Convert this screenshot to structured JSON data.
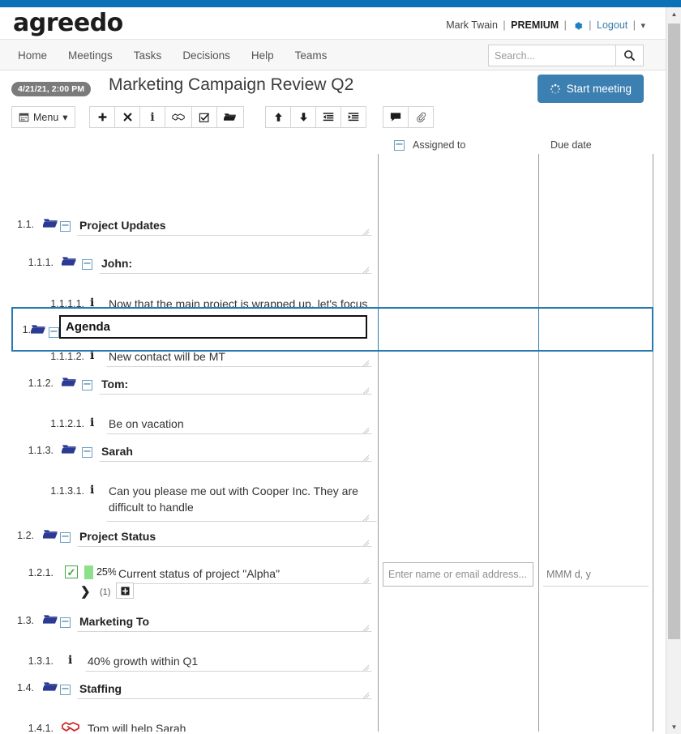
{
  "brand": {
    "name": "agreedo",
    "logo_icon": "agreedo-logo"
  },
  "user": {
    "name": "Mark Twain",
    "plan": "PREMIUM",
    "settings_icon": "gear-icon",
    "logout_label": "Logout",
    "caret_icon": "chevron-down-icon",
    "sep": "|"
  },
  "nav": {
    "items": [
      {
        "label": "Home",
        "name": "nav-home"
      },
      {
        "label": "Meetings",
        "name": "nav-meetings"
      },
      {
        "label": "Tasks",
        "name": "nav-tasks"
      },
      {
        "label": "Decisions",
        "name": "nav-decisions"
      },
      {
        "label": "Help",
        "name": "nav-help"
      },
      {
        "label": "Teams",
        "name": "nav-teams"
      }
    ]
  },
  "search": {
    "placeholder": "Search...",
    "value": "",
    "icon": "search-icon"
  },
  "meeting": {
    "date_badge": "4/21/21, 2:00 PM",
    "title": "Marketing Campaign Review Q2",
    "start_button": "Start meeting",
    "start_button_icon": "spinner-icon"
  },
  "toolbar": {
    "menu_label": "Menu",
    "menu_icon": "calendar-icon",
    "menu_caret": "▾",
    "group1": [
      {
        "icon": "plus-icon",
        "glyph": "✚",
        "name": "add-item-button"
      },
      {
        "icon": "close-icon",
        "glyph": "✖",
        "name": "delete-item-button"
      },
      {
        "icon": "info-icon",
        "glyph": "i",
        "name": "info-item-button"
      },
      {
        "icon": "handshake-icon",
        "glyph": "handshake",
        "name": "decision-item-button"
      },
      {
        "icon": "checkbox-icon",
        "glyph": "☑",
        "name": "task-item-button"
      },
      {
        "icon": "folder-icon",
        "glyph": "folder",
        "name": "topic-item-button"
      }
    ],
    "group2": [
      {
        "icon": "arrow-up-icon",
        "glyph": "↑",
        "name": "move-up-button"
      },
      {
        "icon": "arrow-down-icon",
        "glyph": "↓",
        "name": "move-down-button"
      },
      {
        "icon": "outdent-icon",
        "glyph": "outdent",
        "name": "outdent-button"
      },
      {
        "icon": "indent-icon",
        "glyph": "indent",
        "name": "indent-button"
      }
    ],
    "group3": [
      {
        "icon": "comment-icon",
        "glyph": "💬",
        "name": "comment-button"
      },
      {
        "icon": "paperclip-icon",
        "glyph": "attach",
        "name": "attachment-button"
      }
    ]
  },
  "columns": {
    "collapse_icon": "minus-box-icon",
    "assigned_to": "Assigned to",
    "due_date": "Due date"
  },
  "rows": [
    {
      "number": "1.",
      "type": "topic",
      "text": "Agenda",
      "selected": true,
      "editing": true
    },
    {
      "number": "1.1.",
      "type": "topic",
      "text": "Project Updates"
    },
    {
      "number": "1.1.1.",
      "type": "topic",
      "text": "John:"
    },
    {
      "number": "1.1.1.1.",
      "type": "info",
      "text": "Now that the main project is wrapped up, let's focus on new goals"
    },
    {
      "number": "1.1.1.2.",
      "type": "info",
      "text": "New contact will be MT"
    },
    {
      "number": "1.1.2.",
      "type": "topic",
      "text": "Tom:"
    },
    {
      "number": "1.1.2.1.",
      "type": "info",
      "text": "Be on vacation"
    },
    {
      "number": "1.1.3.",
      "type": "topic",
      "text": "Sarah"
    },
    {
      "number": "1.1.3.1.",
      "type": "info",
      "text": "Can you please me out with Cooper Inc. They are difficult to handle"
    },
    {
      "number": "1.2.",
      "type": "topic",
      "text": "Project Status"
    },
    {
      "number": "1.2.1.",
      "type": "task",
      "text": "Current status of project \"Alpha\"",
      "progress": "25%",
      "progress_value": 25,
      "checked": true
    },
    {
      "number": "1.3.",
      "type": "topic",
      "text": "Marketing To"
    },
    {
      "number": "1.3.1.",
      "type": "info",
      "text": "40% growth within Q1"
    },
    {
      "number": "1.4.",
      "type": "topic",
      "text": "Staffing"
    },
    {
      "number": "1.4.1.",
      "type": "decision",
      "text": "Tom will help Sarah"
    }
  ],
  "subrow": {
    "chevron_icon": "chevron-right-icon",
    "count": "(1)",
    "add_icon": "plus-square-icon"
  },
  "assign_field": {
    "placeholder": "Enter name or email address...",
    "value": ""
  },
  "due_field": {
    "placeholder": "MMM d, y",
    "value": ""
  },
  "colors": {
    "top_strip": "#0b72b5",
    "accent": "#3c7fb1",
    "selection": "#2a7ab0",
    "progress": "#8ce08c",
    "check": "#3fa63f",
    "folder": "#2b3a92",
    "decision": "#cc2222",
    "badge": "#7b7b7b"
  },
  "scrollbar": {
    "up_icon": "scroll-up-arrow",
    "down_icon": "scroll-down-arrow"
  }
}
